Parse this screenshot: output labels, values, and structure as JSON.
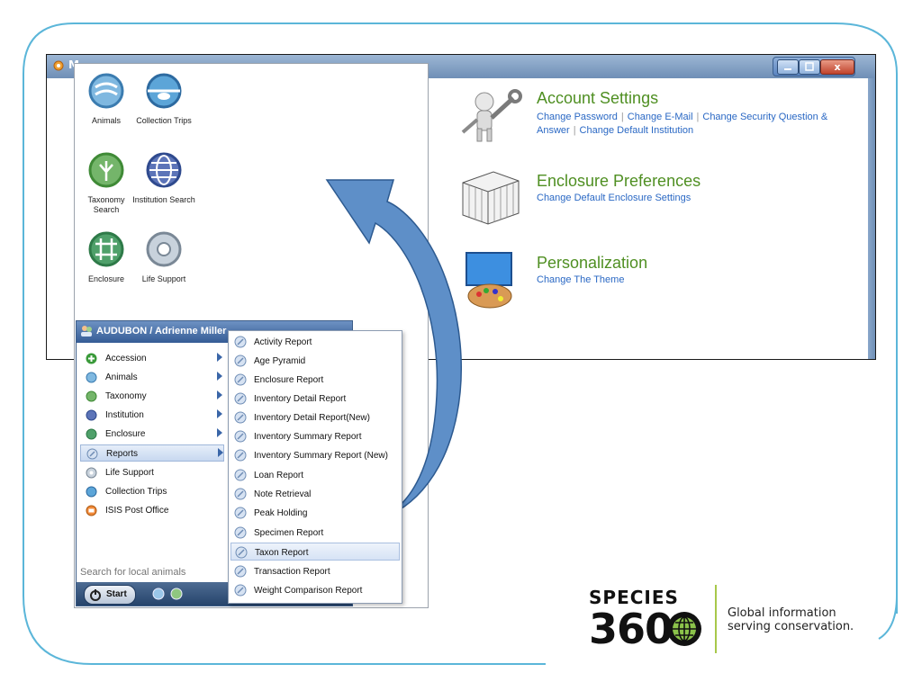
{
  "window": {
    "title": "M",
    "close_label": "x"
  },
  "settings": {
    "account": {
      "title": "Account Settings",
      "links": [
        "Change Password",
        "Change E-Mail",
        "Change Security Question &",
        "Answer",
        "Change Default Institution"
      ]
    },
    "enclosure": {
      "title": "Enclosure Preferences",
      "links": [
        "Change Default Enclosure Settings"
      ]
    },
    "personalization": {
      "title": "Personalization",
      "links": [
        "Change The Theme"
      ]
    }
  },
  "desktop": {
    "icons": [
      {
        "label": "Animals",
        "icon": "animals-icon"
      },
      {
        "label": "Collection Trips",
        "icon": "collection-trips-icon"
      },
      {
        "label": "Taxonomy Search",
        "icon": "taxonomy-search-icon"
      },
      {
        "label": "Institution Search",
        "icon": "institution-search-icon"
      },
      {
        "label": "Enclosure",
        "icon": "enclosure-icon"
      },
      {
        "label": "Life Support",
        "icon": "life-support-icon"
      }
    ]
  },
  "start_menu": {
    "user": "AUDUBON / Adrienne Miller",
    "items": [
      {
        "label": "Accession",
        "icon": "accession-icon",
        "submenu": true
      },
      {
        "label": "Animals",
        "icon": "animals-icon",
        "submenu": true
      },
      {
        "label": "Taxonomy",
        "icon": "taxonomy-icon",
        "submenu": true
      },
      {
        "label": "Institution",
        "icon": "institution-icon",
        "submenu": true
      },
      {
        "label": "Enclosure",
        "icon": "enclosure-icon",
        "submenu": true
      },
      {
        "label": "Reports",
        "icon": "reports-icon",
        "submenu": true,
        "selected": true
      },
      {
        "label": "Life Support",
        "icon": "life-support-icon",
        "submenu": false
      },
      {
        "label": "Collection Trips",
        "icon": "collection-trips-icon",
        "submenu": false
      },
      {
        "label": "ISIS Post Office",
        "icon": "post-office-icon",
        "submenu": false
      }
    ],
    "search_placeholder": "Search for local animals",
    "start_label": "Start"
  },
  "reports_submenu": {
    "items": [
      "Activity Report",
      "Age Pyramid",
      "Enclosure Report",
      "Inventory Detail Report",
      "Inventory Detail Report(New)",
      "Inventory Summary Report",
      "Inventory Summary Report (New)",
      "Loan Report",
      "Note Retrieval",
      "Peak Holding",
      "Specimen Report",
      "Taxon Report",
      "Transaction Report",
      "Weight Comparison Report"
    ],
    "highlighted": "Taxon Report"
  },
  "logo": {
    "line1": "SPECIES",
    "line2": "360",
    "tagline1": "Global information",
    "tagline2": "serving conservation."
  },
  "colors": {
    "accent_green": "#4f8f22",
    "link_blue": "#2a68c4",
    "arrow_blue": "#5e8fc8"
  }
}
